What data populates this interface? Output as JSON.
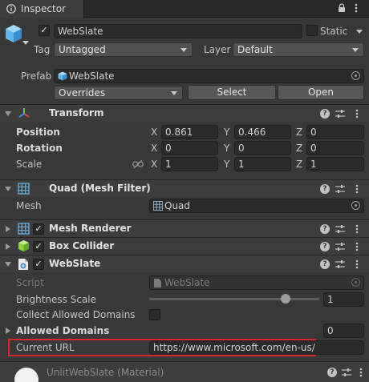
{
  "window": {
    "tab_label": "Inspector",
    "lock_icon": "lock-icon",
    "menu_icon": "kebab-menu-icon"
  },
  "gameobject": {
    "name": "WebSlate",
    "active": true,
    "static_label": "Static",
    "static_checked": false,
    "tag_label": "Tag",
    "tag_value": "Untagged",
    "layer_label": "Layer",
    "layer_value": "Default",
    "prefab_label": "Prefab",
    "prefab_value": "WebSlate",
    "overrides_value": "Overrides",
    "select_label": "Select",
    "open_label": "Open"
  },
  "transform": {
    "title": "Transform",
    "position_label": "Position",
    "rotation_label": "Rotation",
    "scale_label": "Scale",
    "axis_x": "X",
    "axis_y": "Y",
    "axis_z": "Z",
    "position": {
      "x": "0.861",
      "y": "0.466",
      "z": "0"
    },
    "rotation": {
      "x": "0",
      "y": "0",
      "z": "0"
    },
    "scale": {
      "x": "1",
      "y": "1",
      "z": "1"
    }
  },
  "mesh_filter": {
    "title": "Quad (Mesh Filter)",
    "mesh_label": "Mesh",
    "mesh_value": "Quad"
  },
  "mesh_renderer": {
    "title": "Mesh Renderer",
    "enabled": true
  },
  "box_collider": {
    "title": "Box Collider",
    "enabled": true
  },
  "webslate": {
    "title": "WebSlate",
    "enabled": true,
    "script_label": "Script",
    "script_value": "WebSlate",
    "brightness_label": "Brightness Scale",
    "brightness_value": "1",
    "brightness_fraction": 0.8,
    "collect_label": "Collect Allowed Domains",
    "collect_checked": false,
    "allowed_label": "Allowed Domains",
    "allowed_count": "0",
    "url_label": "Current URL",
    "url_value": "https://www.microsoft.com/en-us/"
  },
  "material": {
    "title": "UnlitWebSlate (Material)"
  },
  "colors": {
    "background": "#383838",
    "header": "#3d3d3d",
    "field": "#2a2a2a",
    "highlight": "#d22b2b",
    "transform_red": "#e0463c",
    "transform_green": "#6cc24a",
    "transform_blue": "#3c8ce0",
    "cube_blue": "#5fb7ee",
    "collider_green": "#8bd53a"
  }
}
